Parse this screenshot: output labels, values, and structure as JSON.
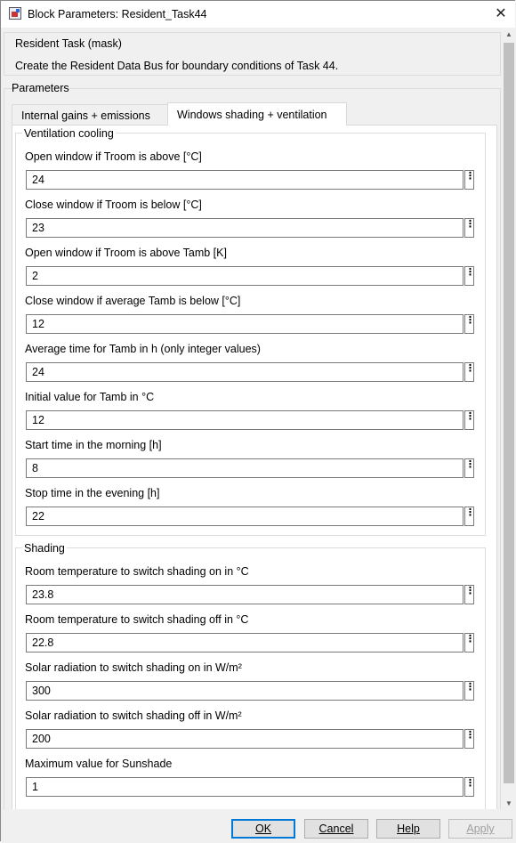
{
  "window": {
    "title": "Block Parameters: Resident_Task44"
  },
  "mask": {
    "title": "Resident Task (mask)",
    "description": "Create the Resident Data Bus for boundary conditions of Task 44."
  },
  "parameters_label": "Parameters",
  "tabs": [
    {
      "label": "Internal gains + emissions",
      "selected": false
    },
    {
      "label": "Windows shading + ventilation",
      "selected": true
    }
  ],
  "ventilation": {
    "title": "Ventilation cooling",
    "fields": [
      {
        "label": "Open window if Troom is above [°C]",
        "value": "24"
      },
      {
        "label": "Close window if Troom is below [°C]",
        "value": "23"
      },
      {
        "label": "Open window if Troom is above Tamb [K]",
        "value": "2"
      },
      {
        "label": "Close window if average Tamb is below [°C]",
        "value": "12"
      },
      {
        "label": "Average time for Tamb in h (only integer values)",
        "value": "24"
      },
      {
        "label": "Initial value for Tamb in °C",
        "value": "12"
      },
      {
        "label": "Start time in the morning [h]",
        "value": "8"
      },
      {
        "label": "Stop time in the evening [h]",
        "value": "22"
      }
    ]
  },
  "shading": {
    "title": "Shading",
    "fields": [
      {
        "label": "Room temperature to switch shading on in °C",
        "value": "23.8"
      },
      {
        "label": "Room temperature to switch shading off in °C",
        "value": "22.8"
      },
      {
        "label": "Solar radiation to switch shading on in W/m²",
        "value": "300"
      },
      {
        "label": "Solar radiation to switch shading off in W/m²",
        "value": "200"
      },
      {
        "label": "Maximum value for Sunshade",
        "value": "1"
      }
    ]
  },
  "buttons": {
    "ok": "OK",
    "cancel": "Cancel",
    "help": "Help",
    "apply": "Apply"
  },
  "field_menu_glyph": "⋮"
}
